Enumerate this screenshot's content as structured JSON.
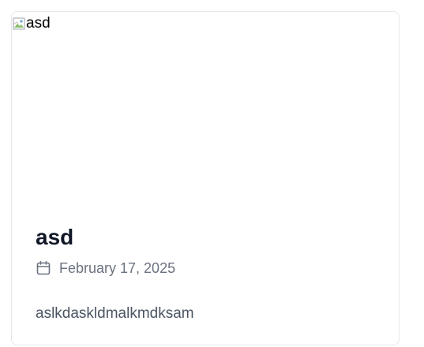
{
  "post": {
    "image_alt": "asd",
    "title": "asd",
    "date": "February 17, 2025",
    "excerpt": "aslkdaskldmalkmdksam"
  },
  "icons": {
    "broken_image": "broken-image-icon",
    "date": "calendar-icon"
  },
  "colors": {
    "border": "#e5e7eb",
    "title": "#111827",
    "meta": "#6b7280",
    "excerpt": "#4b5563"
  }
}
